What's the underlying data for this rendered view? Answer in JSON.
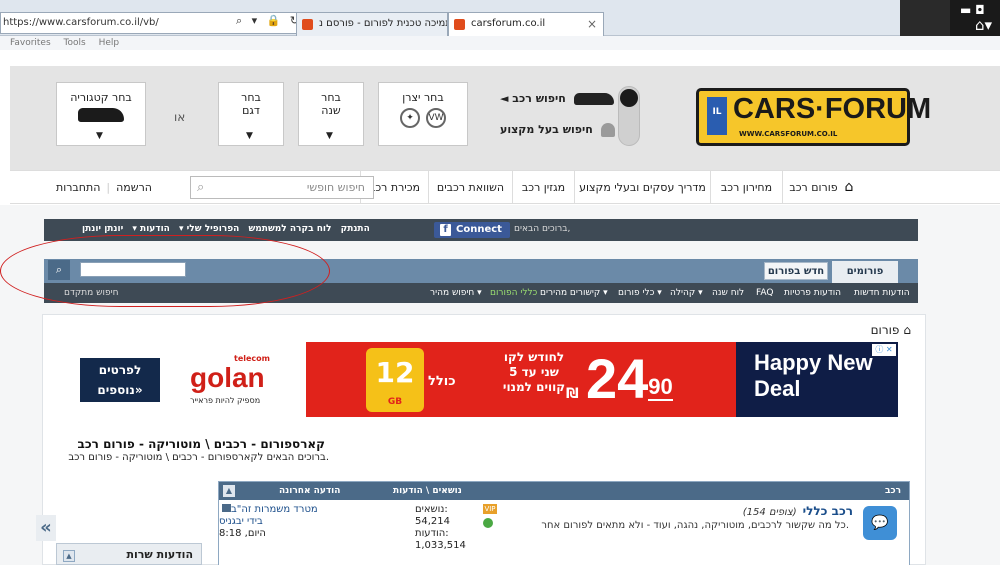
{
  "browser": {
    "url": "https://www.carsforum.co.il/vb/",
    "tabs": [
      {
        "label": "תמיכה טכנית לפורום - פורסם נ..."
      },
      {
        "label": "carsforum.co.il"
      }
    ],
    "menu": [
      "Favorites",
      "Tools",
      "Help"
    ],
    "tab_close": "×"
  },
  "header": {
    "logo_text": "CARS·FORUM",
    "logo_url": "WWW.CARSFORUM.CO.IL",
    "logo_plate": "IL",
    "search_car_label": "חיפוש רכב",
    "search_pro_label": "חיפוש בעל מקצוע",
    "boxes": {
      "maker": "בחר יצרן",
      "year_line1": "בחר",
      "year_line2": "שנה",
      "model_line1": "בחר",
      "model_line2": "דגם",
      "category": "בחר קטגוריה"
    },
    "or_text": "או",
    "arrow": "▼"
  },
  "nav": {
    "items": [
      "פורום רכב",
      "מחירון רכב",
      "מדריך עסקים ובעלי מקצוע",
      "מגזין רכב",
      "השוואת רכבים",
      "מכירת רכב"
    ],
    "search_placeholder": "חיפוש חופשי",
    "login": "התחברות",
    "register": "הרשמה"
  },
  "forum_bar": {
    "connect": "Connect",
    "welcome": "ברוכים הבאים,",
    "username": "יונתן יונתן",
    "links": [
      "הודעות ▾",
      "הפרופיל שלי ▾",
      "לוח בקרה למשתמש",
      "התנתק"
    ]
  },
  "forum_tabs": {
    "forums": "פורומים",
    "new_posts": "חדש בפורום"
  },
  "sub_nav": {
    "links": [
      "הודעות חדשות",
      "הודעות פרטיות",
      "FAQ",
      "לוח שנה",
      "קהילה ▾",
      "כלי פורום ▾",
      "קישורים מהירים ▾",
      "כללי הפורום",
      "חיפוש מהיר ▾"
    ],
    "advanced_search": "חיפוש מתקדם"
  },
  "content": {
    "breadcrumb": "פורום",
    "banner": {
      "golan_small": "telecom",
      "golan": "golan",
      "golan_tag": "מספיק להיות פראייר",
      "cta": "לפרטים נוספים»",
      "gb": "12",
      "gb_unit": "GB",
      "kolel": "כולל",
      "lines": "לחודש לקו שני עד 5 קווים למנוי",
      "price": "24",
      "price_cents": "90",
      "shekel": "₪",
      "happy": "Happy New Deal"
    },
    "title": "קארספורום - רכבים \\ מוטוריקה - פורום רכב",
    "subtitle": "ברוכים הבאים לקארספורום - רכבים \\ מוטוריקה - פורום רכב.",
    "table": {
      "col_forum": "רכב",
      "col_stats": "נושאים \\ הודעות",
      "col_last": "הודעה אחרונה",
      "collapse": "▲",
      "row": {
        "title": "רכב כללי",
        "viewers": "(צופים 154)",
        "description": "כל מה שקשור לרכבים, מוטוריקה, נהגה, ועוד - ולא מתאים לפורום אחר.",
        "topics_label": "נושאים:",
        "topics": "54,214",
        "posts_label": "הודעות:",
        "posts": "1,033,514",
        "badge": "VIP",
        "last_title": "מטרד משמרות זה\"ב",
        "last_user": "בידי יבגניס",
        "last_time": "היום, 8:18"
      }
    }
  },
  "sidebar": {
    "toggle": "«",
    "title": "הודעות שרות"
  }
}
